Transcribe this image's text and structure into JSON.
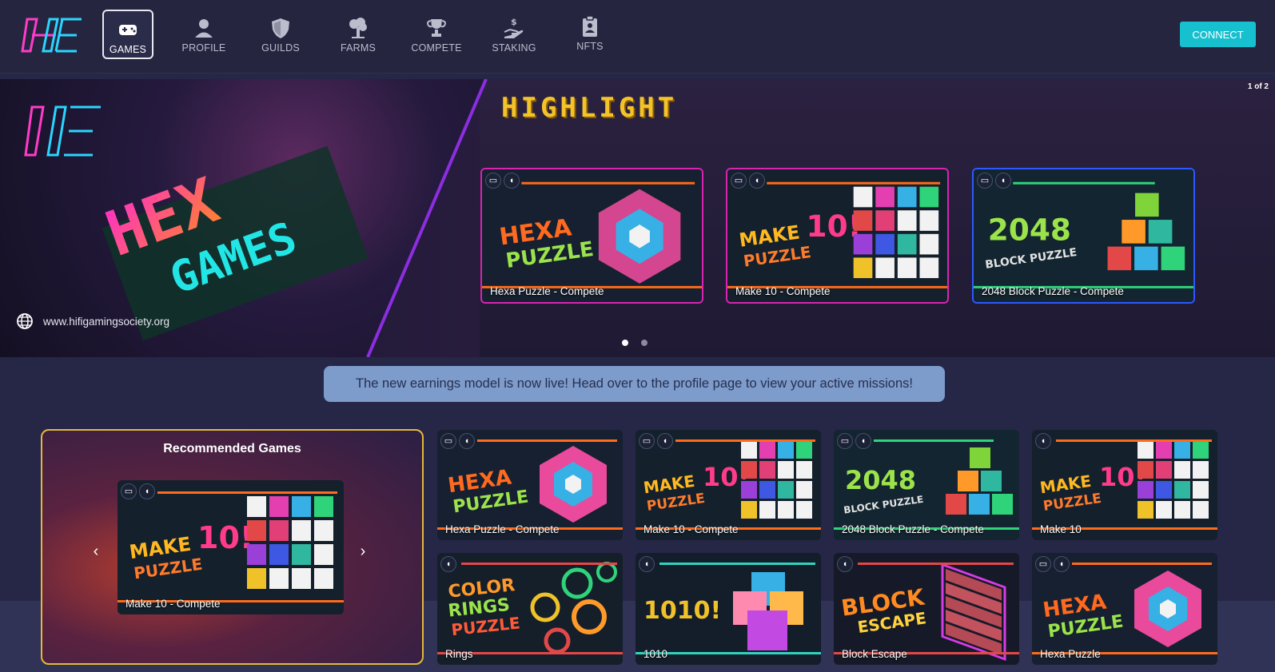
{
  "nav": {
    "items": [
      {
        "label": "GAMES",
        "icon": "gamepad-icon"
      },
      {
        "label": "PROFILE",
        "icon": "person-icon"
      },
      {
        "label": "GUILDS",
        "icon": "shield-icon"
      },
      {
        "label": "FARMS",
        "icon": "tree-icon"
      },
      {
        "label": "COMPETE",
        "icon": "trophy-icon"
      },
      {
        "label": "STAKING",
        "icon": "staking-hand-icon"
      },
      {
        "label": "NFTS",
        "icon": "clipboard-badge-icon"
      }
    ],
    "active": "GAMES",
    "connect_label": "CONNECT"
  },
  "banner": {
    "page_indicator": "1 of 2",
    "title": "HIGHLIGHT",
    "logo_text": "HEX GAMES",
    "url": "www.hifigamingsociety.org",
    "slides_total": 2,
    "slide_active": 1,
    "games": [
      {
        "name": "Hexa Puzzle - Compete"
      },
      {
        "name": "Make 10 - Compete"
      },
      {
        "name": "2048 Block Puzzle - Compete"
      }
    ]
  },
  "notice": "The new earnings model is now live! Head over to the profile page to view your active missions!",
  "recommended": {
    "title": "Recommended Games",
    "current": "Make 10 - Compete"
  },
  "grid": [
    {
      "name": "Hexa Puzzle - Compete"
    },
    {
      "name": "Make 10 - Compete"
    },
    {
      "name": "2048 Block Puzzle - Compete"
    },
    {
      "name": "Make 10"
    },
    {
      "name": "Rings"
    },
    {
      "name": "1010"
    },
    {
      "name": "Block Escape"
    },
    {
      "name": "Hexa Puzzle"
    }
  ],
  "colors": {
    "accent": "#17c0cf",
    "highlight": "#f2c42a",
    "notice_bg": "#7d9bcb",
    "reco_border": "#e3b93a"
  }
}
